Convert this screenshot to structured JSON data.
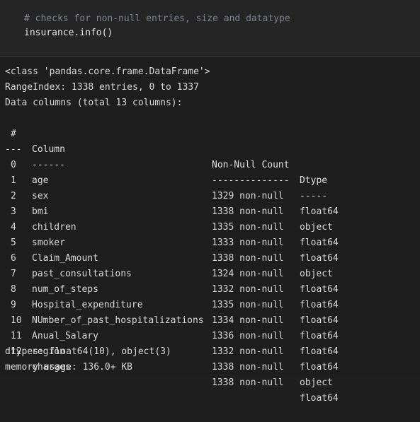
{
  "code_cell": {
    "comment": "# checks for non-null entries, size and datatype",
    "code": "insurance.info()"
  },
  "output": {
    "class_line": "<class 'pandas.core.frame.DataFrame'>",
    "range_index": "RangeIndex: 1338 entries, 0 to 1337",
    "data_columns": "Data columns (total 13 columns):",
    "headers": {
      "index": "#",
      "column": "Column",
      "count": "Non-Null Count",
      "dtype": "Dtype"
    },
    "separators": {
      "index": "---",
      "column": "------",
      "count": "--------------",
      "dtype": "-----"
    },
    "rows": [
      {
        "index": "0",
        "column": "age",
        "count": "1329 non-null",
        "dtype": "float64"
      },
      {
        "index": "1",
        "column": "sex",
        "count": "1338 non-null",
        "dtype": "object"
      },
      {
        "index": "2",
        "column": "bmi",
        "count": "1335 non-null",
        "dtype": "float64"
      },
      {
        "index": "3",
        "column": "children",
        "count": "1333 non-null",
        "dtype": "float64"
      },
      {
        "index": "4",
        "column": "smoker",
        "count": "1338 non-null",
        "dtype": "object"
      },
      {
        "index": "5",
        "column": "Claim_Amount",
        "count": "1324 non-null",
        "dtype": "float64"
      },
      {
        "index": "6",
        "column": "past_consultations",
        "count": "1332 non-null",
        "dtype": "float64"
      },
      {
        "index": "7",
        "column": "num_of_steps",
        "count": "1335 non-null",
        "dtype": "float64"
      },
      {
        "index": "8",
        "column": "Hospital_expenditure",
        "count": "1334 non-null",
        "dtype": "float64"
      },
      {
        "index": "9",
        "column": "NUmber_of_past_hospitalizations",
        "count": "1336 non-null",
        "dtype": "float64"
      },
      {
        "index": "10",
        "column": "Anual_Salary",
        "count": "1332 non-null",
        "dtype": "float64"
      },
      {
        "index": "11",
        "column": "region",
        "count": "1338 non-null",
        "dtype": "object"
      },
      {
        "index": "12",
        "column": "charges",
        "count": "1338 non-null",
        "dtype": "float64"
      }
    ],
    "dtypes_line": "dtypes: float64(10), object(3)",
    "memory_line": "memory usage: 136.0+ KB"
  }
}
